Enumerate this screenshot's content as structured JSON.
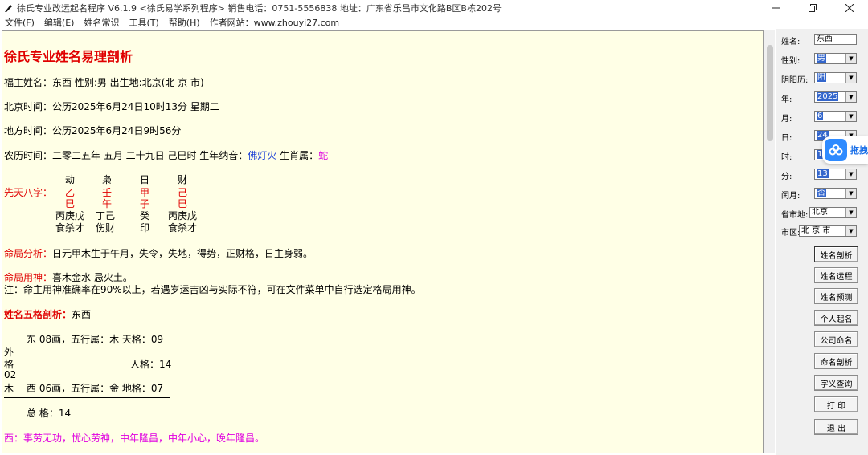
{
  "window": {
    "title": "徐氏专业改运起名程序 V6.1.9 <徐氏易学系列程序>    销售电话：0751-5556838    地址：广东省乐昌市文化路B区B栋202号"
  },
  "menu": [
    "文件(F)",
    "编辑(E)",
    "姓名常识",
    "工具(T)",
    "帮助(H)",
    "作者网站：www.zhouyi27.com"
  ],
  "report": {
    "headline": "徐氏专业姓名易理剖析",
    "owner": "福主姓名：东西  性别:男   出生地:北京(北 京 市)",
    "beijing_time": "北京时间：公历2025年6月24日10时13分   星期二",
    "local_time": "地方时间：公历2025年6月24日9时56分",
    "lunar_prefix": "农历时间：二零二五年 五月 二十九日 己巳时     生年纳音：",
    "nayin": "佛灯火",
    "zodiac_label": "   生肖属：",
    "zodiac": "蛇",
    "bazi_label": "先天八字：",
    "bazi_gods": [
      "劫",
      "枭",
      "日",
      "财"
    ],
    "bazi_stems": [
      "乙",
      "壬",
      "甲",
      "己"
    ],
    "bazi_branches": [
      "巳",
      "午",
      "子",
      "巳"
    ],
    "bazi_hidden": [
      "丙庚戊",
      "丁己",
      "癸",
      "丙庚戊"
    ],
    "bazi_hidden_gods": [
      "食杀才",
      "伤财",
      "印",
      "食杀才"
    ],
    "mingju_label": "命局分析：",
    "mingju_text": "日元甲木生于午月，失令，失地，得势，正财格，日主身弱。",
    "yongshen_label": "命局用神：",
    "yongshen_text": "喜木金水 忌火土。",
    "note": "注：命主用神准确率在90%以上，若遇岁运吉凶与实际不符，可在文件菜单中自行选定格局用神。",
    "wuge_label": "姓名五格剖析：",
    "wuge_name": "东西",
    "wuge_row1": "东 08画，五行属：木    天格：09",
    "wuge_outer": [
      "外",
      "格",
      "02",
      "木"
    ],
    "wuge_ren": "人格：14",
    "wuge_row3": "西 06画，五行属：金    地格：07",
    "wuge_total": "总   格：14",
    "fortune": "西：事劳无功，忧心劳神，中年隆昌，中年小心，晚年隆昌。"
  },
  "sidebar": {
    "fields": [
      {
        "label": "姓名:",
        "value": "东西"
      },
      {
        "label": "性别:",
        "value": "男"
      },
      {
        "label": "阴阳历:",
        "value": "阳"
      },
      {
        "label": "年:",
        "value": "2025"
      },
      {
        "label": "月:",
        "value": "6"
      },
      {
        "label": "日:",
        "value": "24"
      },
      {
        "label": "时:",
        "value": "10"
      },
      {
        "label": "分:",
        "value": "13"
      },
      {
        "label": "闰月:",
        "value": "否"
      },
      {
        "label": "省市地:",
        "value": "北京"
      },
      {
        "label": "市区:",
        "value": "北 京 市"
      }
    ],
    "buttons": [
      "姓名剖析",
      "姓名运程",
      "姓名预测",
      "个人起名",
      "公司命名",
      "命名剖析",
      "字义查询",
      "打  印",
      "退  出"
    ]
  },
  "float_badge": {
    "text": "拖拽"
  },
  "colors": {
    "content_bg": "#ffffe6",
    "red": "#e00000",
    "blue": "#1a3fd6",
    "magenta": "#e000e0",
    "badge": "#2f8bff"
  }
}
